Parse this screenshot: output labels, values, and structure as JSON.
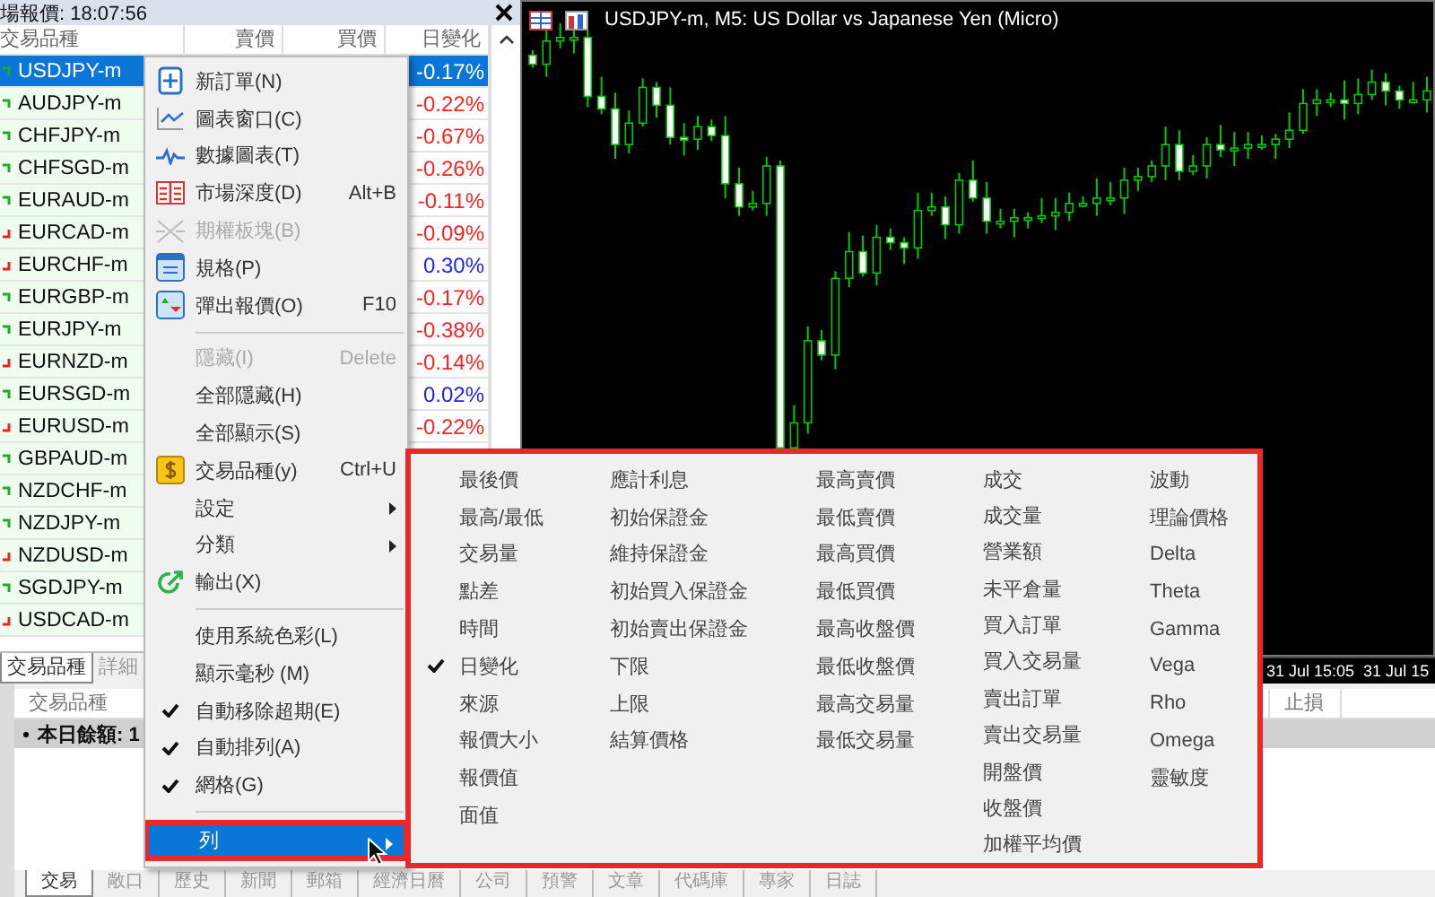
{
  "market_watch": {
    "title": "場報價: 18:07:56",
    "columns": [
      "交易品種",
      "賣價",
      "買價",
      "日變化"
    ],
    "rows": [
      {
        "symbol": "USDJPY-m",
        "rising": true,
        "change": "-0.17%",
        "selected": true
      },
      {
        "symbol": "AUDJPY-m",
        "rising": true,
        "change": "-0.22%",
        "positive": false,
        "selected": false
      },
      {
        "symbol": "CHFJPY-m",
        "rising": true,
        "change": "-0.67%",
        "positive": false,
        "selected": false
      },
      {
        "symbol": "CHFSGD-m",
        "rising": true,
        "change": "-0.26%",
        "positive": false,
        "selected": false
      },
      {
        "symbol": "EURAUD-m",
        "rising": true,
        "change": "-0.11%",
        "positive": false,
        "selected": false
      },
      {
        "symbol": "EURCAD-m",
        "rising": false,
        "change": "-0.09%",
        "positive": false,
        "selected": false
      },
      {
        "symbol": "EURCHF-m",
        "rising": false,
        "change": "0.30%",
        "positive": true,
        "selected": false
      },
      {
        "symbol": "EURGBP-m",
        "rising": true,
        "change": "-0.17%",
        "positive": false,
        "selected": false
      },
      {
        "symbol": "EURJPY-m",
        "rising": true,
        "change": "-0.38%",
        "positive": false,
        "selected": false
      },
      {
        "symbol": "EURNZD-m",
        "rising": false,
        "change": "-0.14%",
        "positive": false,
        "selected": false
      },
      {
        "symbol": "EURSGD-m",
        "rising": true,
        "change": "0.02%",
        "positive": true,
        "selected": false
      },
      {
        "symbol": "EURUSD-m",
        "rising": false,
        "change": "-0.22%",
        "positive": false,
        "selected": false
      },
      {
        "symbol": "GBPAUD-m",
        "rising": true,
        "selected": false
      },
      {
        "symbol": "NZDCHF-m",
        "rising": true,
        "selected": false
      },
      {
        "symbol": "NZDJPY-m",
        "rising": true,
        "selected": false
      },
      {
        "symbol": "NZDUSD-m",
        "rising": false,
        "selected": false
      },
      {
        "symbol": "SGDJPY-m",
        "rising": true,
        "selected": false
      },
      {
        "symbol": "USDCAD-m",
        "rising": false,
        "selected": false
      }
    ],
    "tabs": [
      {
        "label": "交易品種",
        "selected": true
      },
      {
        "label": "詳細",
        "selected": false
      }
    ]
  },
  "chart": {
    "title": "USDJPY-m, M5:  US Dollar vs Japanese Yen (Micro)",
    "time_labels": [
      "31 Jul 15:05",
      "31 Jul 15"
    ]
  },
  "terminal": {
    "columns": [
      "交易品種",
      "止損"
    ],
    "rows": [
      {
        "label": "本日餘額: 1"
      }
    ],
    "tabs": [
      {
        "label": "交易",
        "selected": true
      },
      {
        "label": "敞口",
        "selected": false
      },
      {
        "label": "歷史",
        "selected": false
      },
      {
        "label": "新聞",
        "selected": false
      },
      {
        "label": "郵箱",
        "selected": false
      },
      {
        "label": "經濟日曆",
        "selected": false
      },
      {
        "label": "公司",
        "selected": false
      },
      {
        "label": "預警",
        "selected": false
      },
      {
        "label": "文章",
        "selected": false
      },
      {
        "label": "代碼庫",
        "selected": false
      },
      {
        "label": "專家",
        "selected": false
      },
      {
        "label": "日誌",
        "selected": false
      }
    ]
  },
  "context_menu": {
    "items": [
      {
        "kind": "item",
        "label": "新訂單(N)",
        "disabled": false,
        "checked": false,
        "selected": false
      },
      {
        "kind": "item",
        "label": "圖表窗口(C)",
        "disabled": false,
        "checked": false,
        "selected": false
      },
      {
        "kind": "item",
        "label": "數據圖表(T)",
        "disabled": false,
        "checked": false,
        "selected": false
      },
      {
        "kind": "item",
        "label": "市場深度(D)",
        "shortcut": "Alt+B",
        "disabled": false,
        "checked": false,
        "selected": false
      },
      {
        "kind": "item",
        "label": "期權板塊(B)",
        "disabled": true,
        "checked": false,
        "selected": false
      },
      {
        "kind": "item",
        "label": "規格(P)",
        "disabled": false,
        "checked": false,
        "selected": false
      },
      {
        "kind": "item",
        "label": "彈出報價(O)",
        "shortcut": "F10",
        "disabled": false,
        "checked": false,
        "selected": false
      },
      {
        "kind": "separator"
      },
      {
        "kind": "item",
        "label": "隱藏(I)",
        "shortcut": "Delete",
        "disabled": true,
        "checked": false,
        "selected": false
      },
      {
        "kind": "item",
        "label": "全部隱藏(H)",
        "disabled": false,
        "checked": false,
        "selected": false
      },
      {
        "kind": "item",
        "label": "全部顯示(S)",
        "disabled": false,
        "checked": false,
        "selected": false
      },
      {
        "kind": "item",
        "label": "交易品種(y)",
        "shortcut": "Ctrl+U",
        "disabled": false,
        "checked": false,
        "selected": false
      },
      {
        "kind": "submenu",
        "label": "設定",
        "disabled": false,
        "checked": false,
        "selected": false
      },
      {
        "kind": "submenu",
        "label": "分類",
        "disabled": false,
        "checked": false,
        "selected": false
      },
      {
        "kind": "item",
        "label": "輸出(X)",
        "disabled": false,
        "checked": false,
        "selected": false
      },
      {
        "kind": "separator"
      },
      {
        "kind": "item",
        "label": "使用系統色彩(L)",
        "disabled": false,
        "checked": false,
        "selected": false
      },
      {
        "kind": "item",
        "label": "顯示毫秒 (M)",
        "disabled": false,
        "checked": false,
        "selected": false
      },
      {
        "kind": "item",
        "label": "自動移除超期(E)",
        "disabled": false,
        "checked": true,
        "selected": false
      },
      {
        "kind": "item",
        "label": "自動排列(A)",
        "disabled": false,
        "checked": true,
        "selected": false
      },
      {
        "kind": "item",
        "label": "網格(G)",
        "disabled": false,
        "checked": true,
        "selected": false
      },
      {
        "kind": "separator"
      },
      {
        "kind": "submenu",
        "label": "列",
        "disabled": false,
        "checked": false,
        "selected": true
      }
    ]
  },
  "columns_submenu": {
    "columns": [
      [
        {
          "label": "最後價",
          "checked": false
        },
        {
          "label": "最高/最低",
          "checked": false
        },
        {
          "label": "交易量",
          "checked": false
        },
        {
          "label": "點差",
          "checked": false
        },
        {
          "label": "時間",
          "checked": false
        },
        {
          "label": "日變化",
          "checked": true
        },
        {
          "label": "來源",
          "checked": false
        },
        {
          "label": "報價大小",
          "checked": false
        },
        {
          "label": "報價值",
          "checked": false
        },
        {
          "label": "面值",
          "checked": false
        }
      ],
      [
        {
          "label": "應計利息",
          "checked": false
        },
        {
          "label": "初始保證金",
          "checked": false
        },
        {
          "label": "維持保證金",
          "checked": false
        },
        {
          "label": "初始買入保證金",
          "checked": false
        },
        {
          "label": "初始賣出保證金",
          "checked": false
        },
        {
          "label": "下限",
          "checked": false
        },
        {
          "label": "上限",
          "checked": false
        },
        {
          "label": "結算價格",
          "checked": false
        }
      ],
      [
        {
          "label": "最高賣價",
          "checked": false
        },
        {
          "label": "最低賣價",
          "checked": false
        },
        {
          "label": "最高買價",
          "checked": false
        },
        {
          "label": "最低買價",
          "checked": false
        },
        {
          "label": "最高收盤價",
          "checked": false
        },
        {
          "label": "最低收盤價",
          "checked": false
        },
        {
          "label": "最高交易量",
          "checked": false
        },
        {
          "label": "最低交易量",
          "checked": false
        }
      ],
      [
        {
          "label": "成交",
          "checked": false
        },
        {
          "label": "成交量",
          "checked": false
        },
        {
          "label": "營業額",
          "checked": false
        },
        {
          "label": "未平倉量",
          "checked": false
        },
        {
          "label": "買入訂單",
          "checked": false
        },
        {
          "label": "買入交易量",
          "checked": false
        },
        {
          "label": "賣出訂單",
          "checked": false
        },
        {
          "label": "賣出交易量",
          "checked": false
        },
        {
          "label": "開盤價",
          "checked": false
        },
        {
          "label": "收盤價",
          "checked": false
        },
        {
          "label": "加權平均價",
          "checked": false
        }
      ],
      [
        {
          "label": "波動",
          "checked": false
        },
        {
          "label": "理論價格",
          "checked": false
        },
        {
          "label": "Delta",
          "checked": false
        },
        {
          "label": "Theta",
          "checked": false
        },
        {
          "label": "Gamma",
          "checked": false
        },
        {
          "label": "Vega",
          "checked": false
        },
        {
          "label": "Rho",
          "checked": false
        },
        {
          "label": "Omega",
          "checked": false
        },
        {
          "label": "靈敏度",
          "checked": false
        }
      ]
    ]
  }
}
